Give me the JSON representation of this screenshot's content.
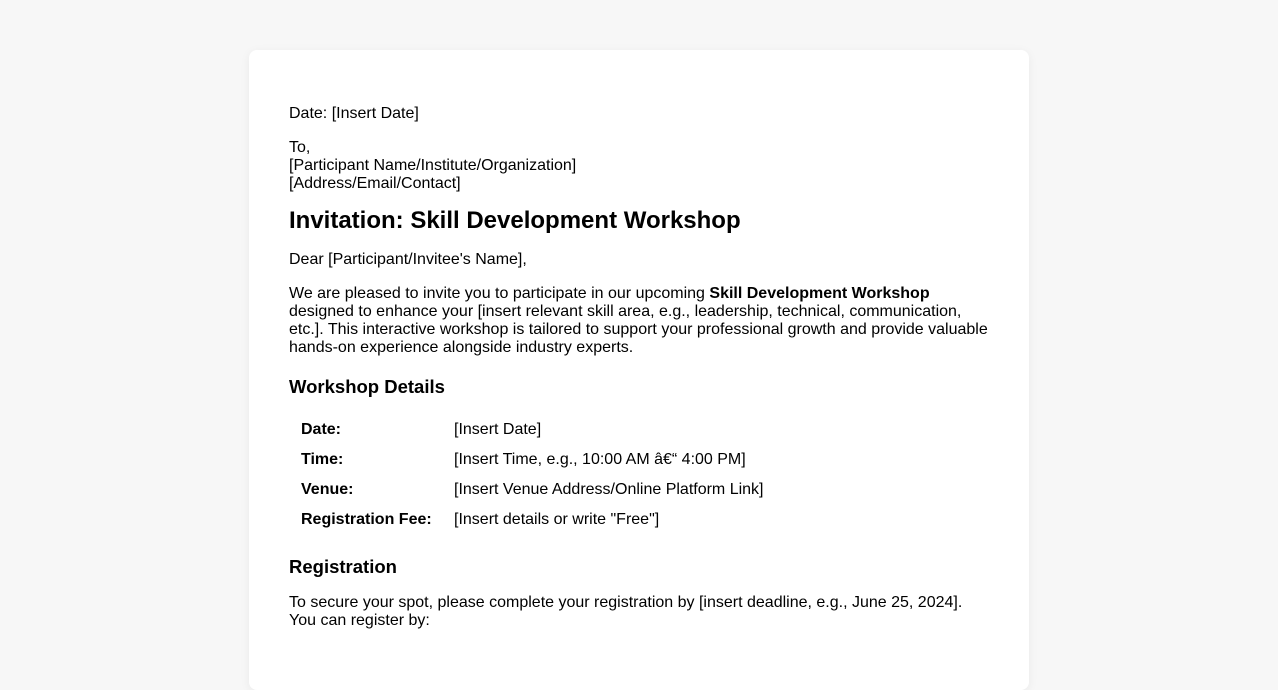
{
  "letter": {
    "date_line": "Date: [Insert Date]",
    "to": "To,",
    "recipient": "[Participant Name/Institute/Organization]",
    "recipient_contact": "[Address/Email/Contact]",
    "title": "Invitation: Skill Development Workshop",
    "greeting": "Dear [Participant/Invitee's Name],",
    "intro_before": "We are pleased to invite you to participate in our upcoming ",
    "intro_bold": "Skill Development Workshop",
    "intro_after": " designed to enhance your [insert relevant skill area, e.g., leadership, technical, communication, etc.]. This interactive workshop is tailored to support your professional growth and provide valuable hands-on experience alongside industry experts."
  },
  "details": {
    "heading": "Workshop Details",
    "rows": [
      {
        "label": "Date:",
        "value": "[Insert Date]"
      },
      {
        "label": "Time:",
        "value": "[Insert Time, e.g., 10:00 AM â€“ 4:00 PM]"
      },
      {
        "label": "Venue:",
        "value": "[Insert Venue Address/Online Platform Link]"
      },
      {
        "label": "Registration Fee:",
        "value": "[Insert details or write \"Free\"]"
      }
    ]
  },
  "registration": {
    "heading": "Registration",
    "text": "To secure your spot, please complete your registration by [insert deadline, e.g., June 25, 2024]. You can register by:"
  }
}
